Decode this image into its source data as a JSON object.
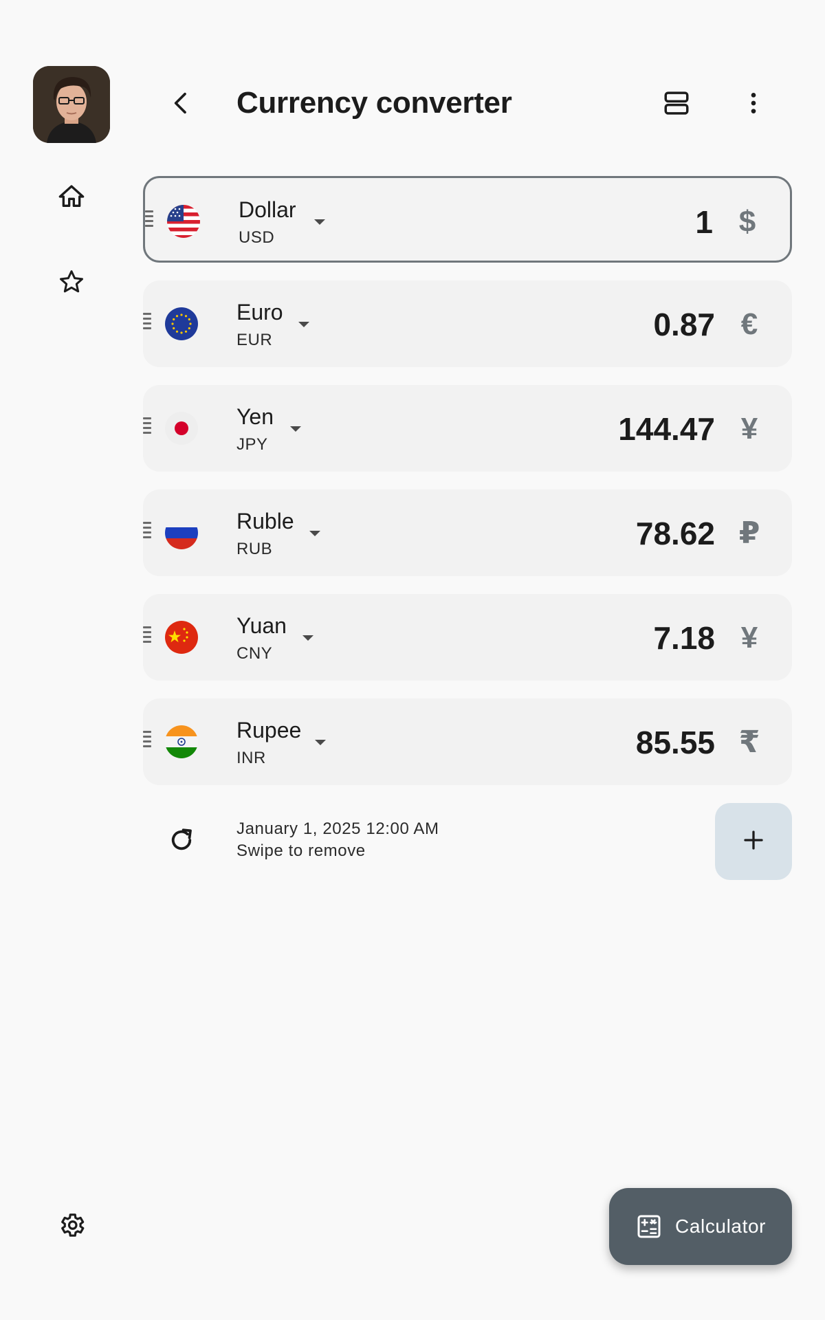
{
  "header": {
    "title": "Currency converter",
    "back_icon": "arrow-back-icon",
    "layout_icon": "view-agenda-icon",
    "more_icon": "more-vert-icon"
  },
  "rail": {
    "avatar_icon": "user-avatar",
    "items": [
      {
        "icon": "home-icon"
      },
      {
        "icon": "star-icon"
      }
    ],
    "settings_icon": "gear-icon"
  },
  "currencies": [
    {
      "name": "Dollar",
      "code": "USD",
      "amount": "1",
      "symbol": "$",
      "flag": "us-flag-icon",
      "selected": true
    },
    {
      "name": "Euro",
      "code": "EUR",
      "amount": "0.87",
      "symbol": "€",
      "flag": "eu-flag-icon",
      "selected": false
    },
    {
      "name": "Yen",
      "code": "JPY",
      "amount": "144.47",
      "symbol": "¥",
      "flag": "jp-flag-icon",
      "selected": false
    },
    {
      "name": "Ruble",
      "code": "RUB",
      "amount": "78.62",
      "symbol": "₽",
      "flag": "ru-flag-icon",
      "selected": false
    },
    {
      "name": "Yuan",
      "code": "CNY",
      "amount": "7.18",
      "symbol": "¥",
      "flag": "cn-flag-icon",
      "selected": false
    },
    {
      "name": "Rupee",
      "code": "INR",
      "amount": "85.55",
      "symbol": "₹",
      "flag": "in-flag-icon",
      "selected": false
    }
  ],
  "footer": {
    "updated": "January 1, 2025 12:00 AM",
    "hint": "Swipe to remove",
    "refresh_icon": "refresh-icon",
    "add_icon": "add-icon"
  },
  "fab": {
    "label": "Calculator",
    "icon": "calculator-icon"
  },
  "colors": {
    "background": "#f9f9f9",
    "card": "#f2f2f2",
    "selected_border": "#70777c",
    "symbol": "#70777c",
    "add_button": "#d8e2e9",
    "fab": "#535e66"
  }
}
